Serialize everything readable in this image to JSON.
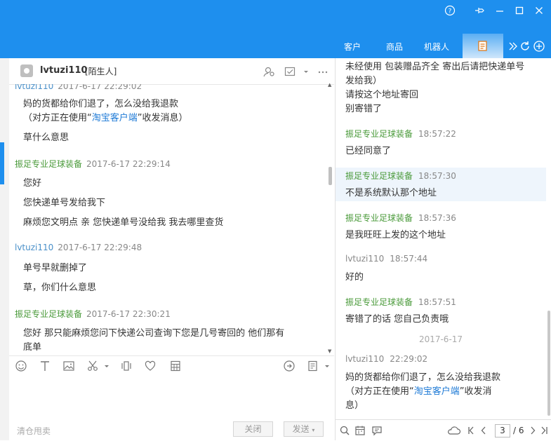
{
  "window_controls": {
    "help": "?",
    "pin": "pin",
    "minimize": "—",
    "maximize": "☐",
    "close": "✕"
  },
  "nav_tabs": [
    "客户",
    "商品",
    "机器人"
  ],
  "left": {
    "contact_name": "lvtuzi110",
    "contact_tag": "[陌生人]",
    "messages": [
      {
        "sender": "lvtuzi110",
        "time": "2017-6-17 22:29:02",
        "lines": [
          "妈的货都给你们退了，怎么没给我退款"
        ],
        "client_prefix": "（对方正在使用“",
        "client_link": "淘宝客户端",
        "client_suffix": "”收发消息）"
      },
      {
        "text": "草什么意思"
      },
      {
        "sender": "振足专业足球装备",
        "time": "2017-6-17 22:29:14"
      },
      {
        "text": "您好"
      },
      {
        "text": "您快递单号发给我下"
      },
      {
        "text": "麻烦您文明点 亲  您快递单号没给我 我去哪里查货"
      },
      {
        "sender": "lvtuzi110",
        "time": "2017-6-17 22:29:48"
      },
      {
        "text": "单号早就删掉了"
      },
      {
        "text": "草，你们什么意思"
      },
      {
        "sender": "振足专业足球装备",
        "time": "2017-6-17 22:30:21"
      },
      {
        "text": "您好 那只能麻烦您问下快递公司查询下您是几号寄回的 他们那有"
      },
      {
        "text": "底单"
      }
    ],
    "input_hint": "清仓甩卖",
    "close_button": "关闭",
    "send_button": "发送"
  },
  "right": {
    "top_lines": [
      "未经使用 包装赠品齐全 寄出后请把快递单号",
      "发给我）",
      "请按这个地址寄回",
      "别寄错了"
    ],
    "entries": [
      {
        "sender": "振足专业足球装备",
        "time": "18:57:22",
        "text": "已经同意了"
      },
      {
        "sender": "振足专业足球装备",
        "time": "18:57:30",
        "text": "不是系统默认那个地址"
      },
      {
        "sender": "振足专业足球装备",
        "time": "18:57:36",
        "text": "是我旺旺上发的这个地址"
      },
      {
        "sender": "lvtuzi110",
        "time": "18:57:44",
        "text": "好的"
      },
      {
        "sender": "振足专业足球装备",
        "time": "18:57:51",
        "text": "寄错了的话  您自己负责哦"
      }
    ],
    "date_separator": "2017-6-17",
    "last_entry": {
      "sender": "lvtuzi110",
      "time": "22:29:02",
      "text": "妈的货都给你们退了，怎么没给我退款",
      "client_prefix": "（对方正在使用“",
      "client_link": "淘宝客户端",
      "client_suffix": "”收发消",
      "client_tail": "息）"
    },
    "page_current": "3",
    "page_total": "/ 6"
  }
}
